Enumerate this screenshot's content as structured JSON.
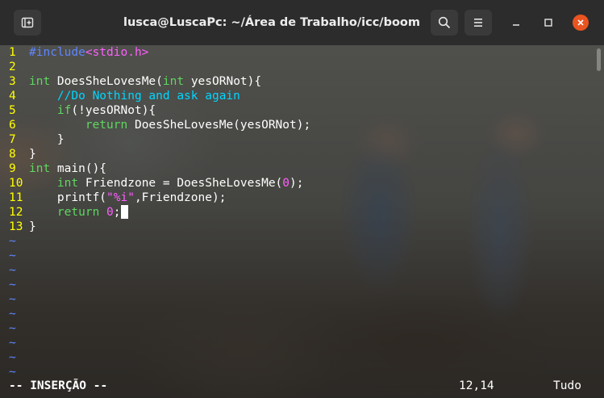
{
  "window": {
    "title": "lusca@LuscaPc: ~/Área de Trabalho/icc/boom",
    "buttons": {
      "new_tab_icon": "new-tab-icon",
      "search_icon": "search-icon",
      "menu_icon": "hamburger-menu-icon",
      "minimize_icon": "minimize-icon",
      "maximize_icon": "maximize-icon",
      "close_icon": "close-icon"
    },
    "colors": {
      "close": "#e95420",
      "titlebar": "#2c2c2c"
    }
  },
  "editor": {
    "lines": [
      {
        "n": "1",
        "parts": [
          [
            "inc",
            "#include"
          ],
          [
            "incf",
            "<stdio.h>"
          ]
        ]
      },
      {
        "n": "2",
        "parts": []
      },
      {
        "n": "3",
        "parts": [
          [
            "typ",
            "int"
          ],
          [
            "code",
            " DoesSheLovesMe("
          ],
          [
            "typ",
            "int"
          ],
          [
            "code",
            " yesORNot){"
          ]
        ]
      },
      {
        "n": "4",
        "parts": [
          [
            "code",
            "    "
          ],
          [
            "cmt",
            "//Do Nothing and ask again"
          ]
        ]
      },
      {
        "n": "5",
        "parts": [
          [
            "code",
            "    "
          ],
          [
            "kw",
            "if"
          ],
          [
            "code",
            "(!yesORNot){"
          ]
        ]
      },
      {
        "n": "6",
        "parts": [
          [
            "code",
            "        "
          ],
          [
            "kw",
            "return"
          ],
          [
            "code",
            " DoesSheLovesMe(yesORNot);"
          ]
        ]
      },
      {
        "n": "7",
        "parts": [
          [
            "code",
            "    }"
          ]
        ]
      },
      {
        "n": "8",
        "parts": [
          [
            "code",
            "}"
          ]
        ]
      },
      {
        "n": "9",
        "parts": [
          [
            "typ",
            "int"
          ],
          [
            "code",
            " main(){"
          ]
        ]
      },
      {
        "n": "10",
        "parts": [
          [
            "code",
            "    "
          ],
          [
            "typ",
            "int"
          ],
          [
            "code",
            " Friendzone = DoesSheLovesMe("
          ],
          [
            "num",
            "0"
          ],
          [
            "code",
            ");"
          ]
        ]
      },
      {
        "n": "11",
        "parts": [
          [
            "code",
            "    printf("
          ],
          [
            "str",
            "\"%i\""
          ],
          [
            "code",
            ",Friendzone);"
          ]
        ]
      },
      {
        "n": "12",
        "parts": [
          [
            "code",
            "    "
          ],
          [
            "kw",
            "return"
          ],
          [
            "code",
            " "
          ],
          [
            "num",
            "0"
          ],
          [
            "code",
            ";"
          ]
        ],
        "cursor": true
      },
      {
        "n": "13",
        "parts": [
          [
            "code",
            "}"
          ]
        ]
      }
    ],
    "tilde_count": 10,
    "tilde_char": "~"
  },
  "status": {
    "mode": "-- INSERÇÃO --",
    "position": "12,14",
    "scroll": "Tudo"
  }
}
